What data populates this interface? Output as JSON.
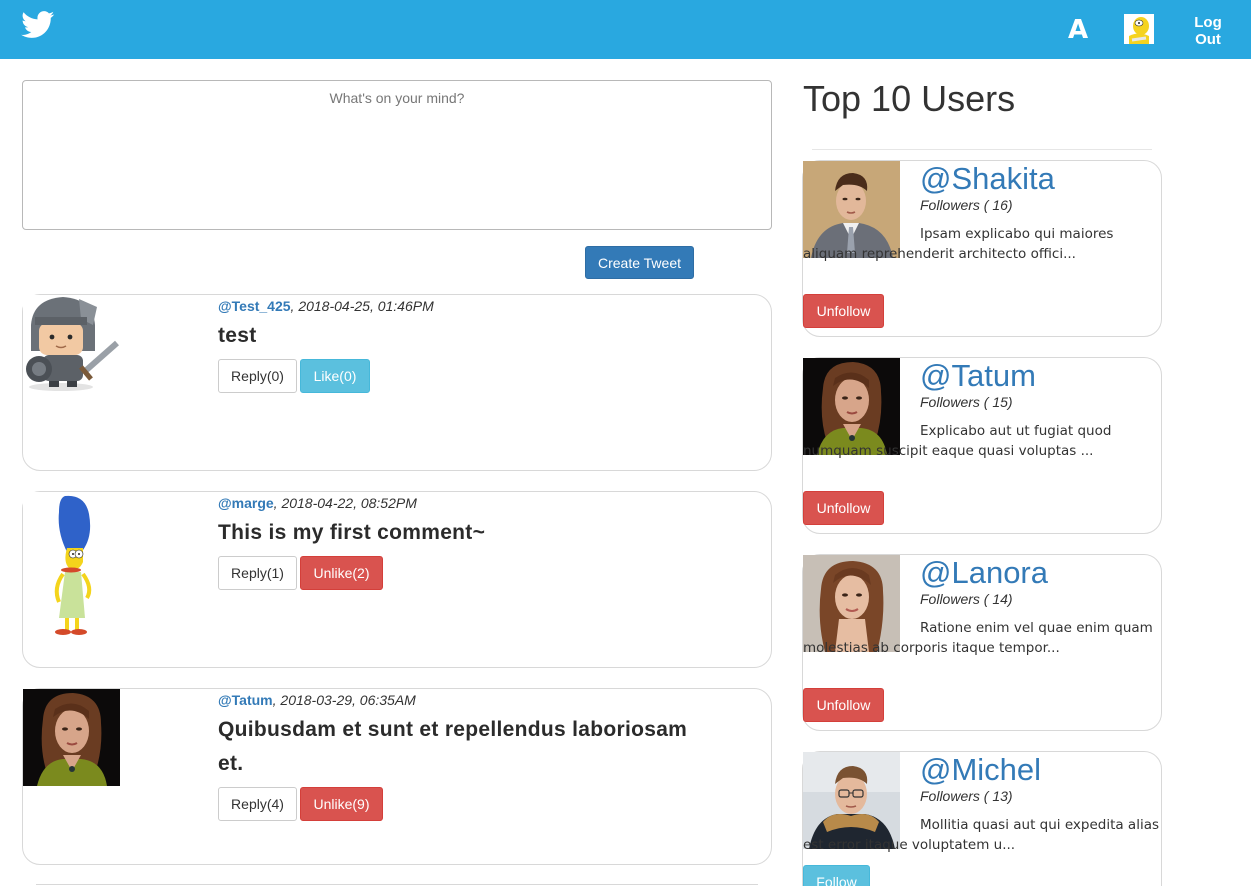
{
  "navbar": {
    "logo_icon": "twitter-bird-icon",
    "brand_color": "#29a8e0",
    "letter": "A",
    "avatar_icon": "user-avatar-icon",
    "logout_line1": "Log",
    "logout_line2": "Out"
  },
  "compose": {
    "placeholder": "What's on your mind?",
    "value": "",
    "button_label": "Create Tweet"
  },
  "feed": [
    {
      "handle": "@Test_425",
      "timestamp": ", 2018-04-25, 01:46PM",
      "text": "test",
      "avatar": "knight-avatar-icon",
      "reply_label": "Reply(0)",
      "like_label": "Like(0)",
      "liked": false
    },
    {
      "handle": "@marge",
      "timestamp": ", 2018-04-22, 08:52PM",
      "text": "This is my first comment~",
      "avatar": "marge-avatar-icon",
      "reply_label": "Reply(1)",
      "like_label": "Unlike(2)",
      "liked": true
    },
    {
      "handle": "@Tatum",
      "timestamp": ", 2018-03-29, 06:35AM",
      "text": "Quibusdam et sunt et repellendus laboriosam et.",
      "avatar": "woman-photo-avatar",
      "reply_label": "Reply(4)",
      "like_label": "Unlike(9)",
      "liked": true
    }
  ],
  "sidebar": {
    "title": "Top 10 Users",
    "users": [
      {
        "handle": "@Shakita",
        "followers": "Followers ( 16)",
        "bio": "Ipsam explicabo qui maiores aliquam reprehenderit architecto offici...",
        "button_label": "Unfollow",
        "following": true
      },
      {
        "handle": "@Tatum",
        "followers": "Followers ( 15)",
        "bio": "Explicabo aut ut fugiat quod numquam suscipit eaque quasi voluptas ...",
        "button_label": "Unfollow",
        "following": true
      },
      {
        "handle": "@Lanora",
        "followers": "Followers ( 14)",
        "bio": "Ratione enim vel quae enim quam molestias ab corporis itaque tempor...",
        "button_label": "Unfollow",
        "following": true
      },
      {
        "handle": "@Michel",
        "followers": "Followers ( 13)",
        "bio": "Mollitia quasi aut qui expedita alias est error itaque voluptatem u...",
        "button_label": "Follow",
        "following": false
      }
    ]
  }
}
